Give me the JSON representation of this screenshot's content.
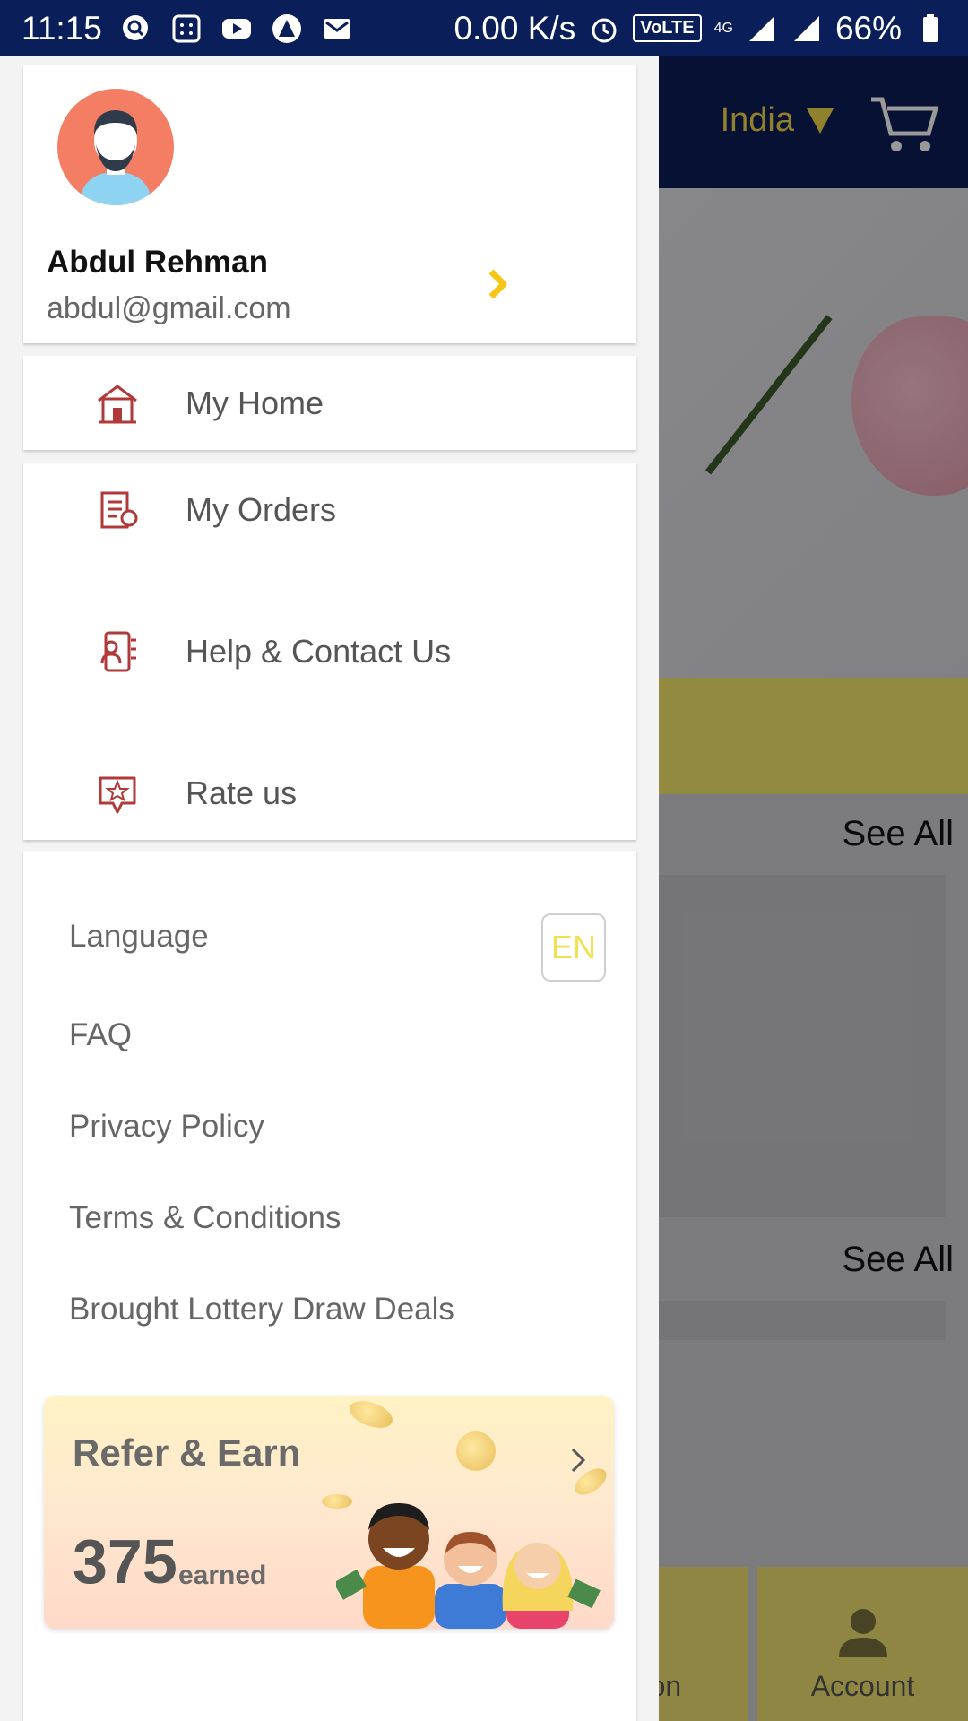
{
  "status_bar": {
    "time": "11:15",
    "speed": "0.00 K/s",
    "volte": "VoLTE",
    "network": "4G",
    "battery": "66%"
  },
  "background_app": {
    "country": "India",
    "see_all_1": "See All",
    "see_all_2": "See All",
    "nav_partial": "cation",
    "nav_account": "Account"
  },
  "drawer": {
    "profile": {
      "name": "Abdul Rehman",
      "email": "abdul@gmail.com"
    },
    "menu": [
      {
        "label": "My Home",
        "icon": "home-icon"
      },
      {
        "label": "My Orders",
        "icon": "orders-icon"
      },
      {
        "label": "Help & Contact Us",
        "icon": "help-contact-icon"
      },
      {
        "label": "Rate us",
        "icon": "rate-us-icon"
      }
    ],
    "settings": {
      "language_label": "Language",
      "language_badge": "EN",
      "faq": "FAQ",
      "privacy": "Privacy Policy",
      "terms": "Terms & Conditions",
      "lottery": "Brought Lottery Draw Deals"
    },
    "refer": {
      "title": "Refer & Earn",
      "count": "375",
      "earned": "earned"
    }
  },
  "colors": {
    "status_bar": "#0a1f5a",
    "accent_yellow": "#f1e14f",
    "icon_red": "#b03a3a",
    "chevron_yellow": "#f5c518"
  }
}
